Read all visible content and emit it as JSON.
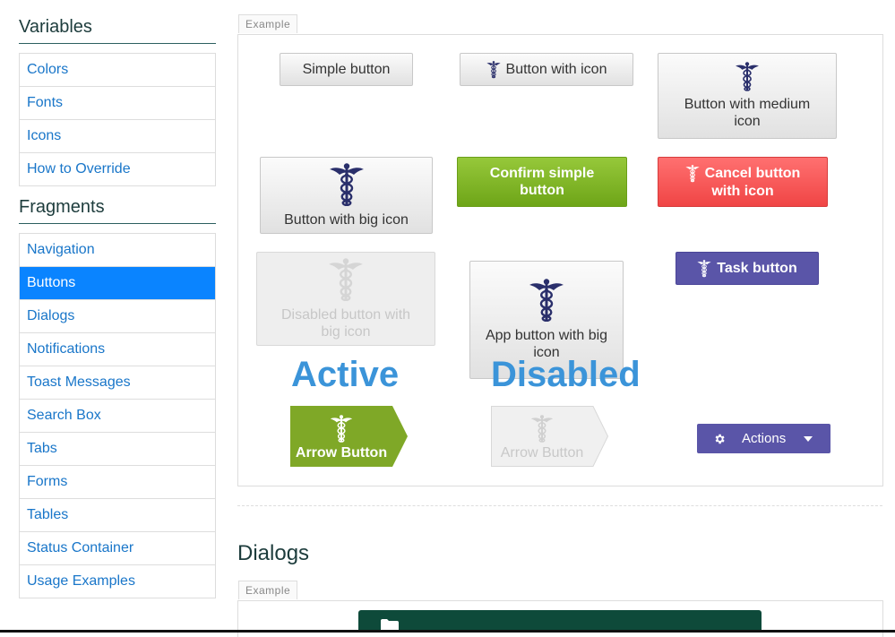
{
  "sidebar": {
    "variables_heading": "Variables",
    "variables": [
      {
        "label": "Colors"
      },
      {
        "label": "Fonts"
      },
      {
        "label": "Icons"
      },
      {
        "label": "How to Override"
      }
    ],
    "fragments_heading": "Fragments",
    "fragments": [
      {
        "label": "Navigation"
      },
      {
        "label": "Buttons",
        "active": true
      },
      {
        "label": "Dialogs"
      },
      {
        "label": "Notifications"
      },
      {
        "label": "Toast Messages"
      },
      {
        "label": "Search Box"
      },
      {
        "label": "Tabs"
      },
      {
        "label": "Forms"
      },
      {
        "label": "Tables"
      },
      {
        "label": "Status Container"
      },
      {
        "label": "Usage Examples"
      }
    ]
  },
  "buttons_example": {
    "tab_label": "Example",
    "simple_button": "Simple button",
    "button_with_icon": "Button with icon",
    "button_medium_icon_line1": "Button with medium",
    "button_medium_icon_line2": "icon",
    "button_big_icon": "Button with big icon",
    "confirm_line1": "Confirm simple",
    "confirm_line2": "button",
    "cancel_line1": "Cancel button",
    "cancel_line2": "with icon",
    "disabled_big_line1": "Disabled button with",
    "disabled_big_line2": "big icon",
    "app_button_line1": "App button with big",
    "app_button_line2": "icon",
    "task_button": "Task button",
    "active_label": "Active",
    "disabled_label": "Disabled",
    "arrow_button": "Arrow Button",
    "arrow_button_disabled": "Arrow Button",
    "actions_button": "Actions"
  },
  "dialogs_section": {
    "title": "Dialogs",
    "tab_label": "Example"
  },
  "colors": {
    "primary_blue": "#0a84ff",
    "link_blue": "#1976c9",
    "green": "#7cb325",
    "red": "#f55353",
    "purple": "#5a55a8",
    "icon_navy": "#1f2a5a",
    "state_label_blue": "#3b94d9"
  },
  "icons": {
    "button_icon": "caduceus-icon",
    "actions_icon": "gear-icon",
    "dropdown_icon": "caret-down-icon",
    "dialog_icon": "folder-icon"
  }
}
